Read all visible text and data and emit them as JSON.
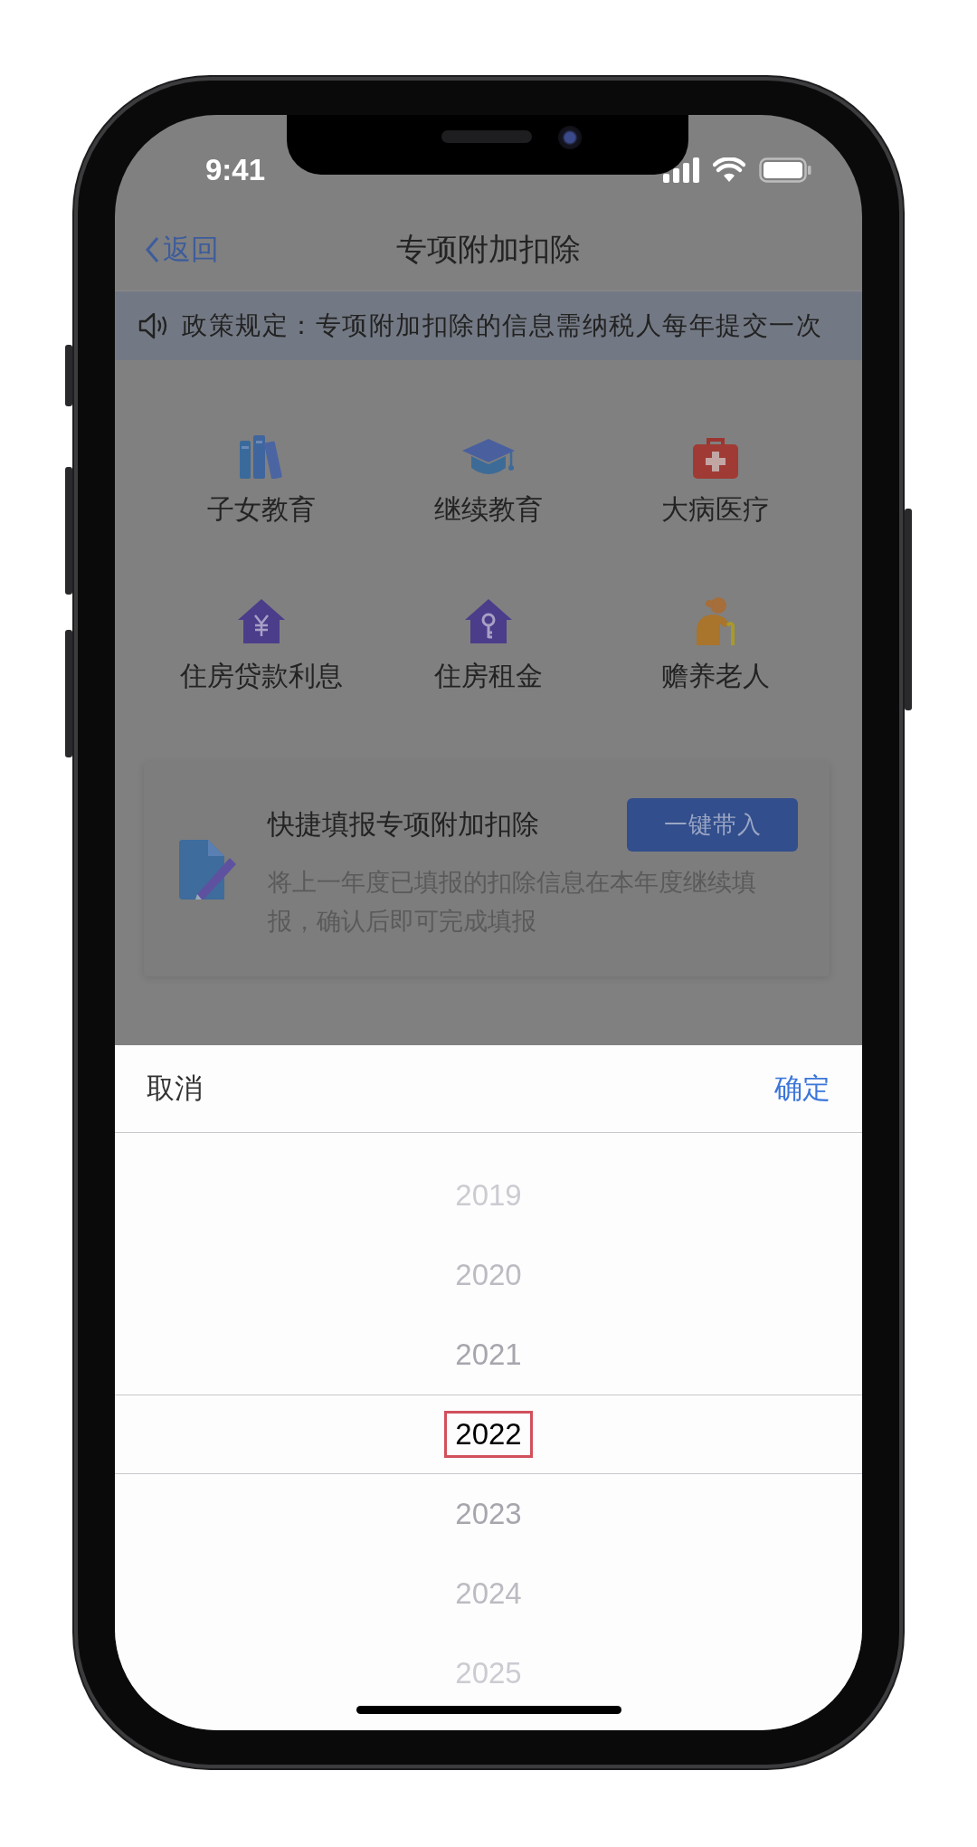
{
  "status_bar": {
    "time": "9:41"
  },
  "nav": {
    "back": "返回",
    "title": "专项附加扣除"
  },
  "notice": {
    "text": "政策规定：专项附加扣除的信息需纳税人每年提交一次"
  },
  "categories": [
    {
      "label": "子女教育"
    },
    {
      "label": "继续教育"
    },
    {
      "label": "大病医疗"
    },
    {
      "label": "住房贷款利息"
    },
    {
      "label": "住房租金"
    },
    {
      "label": "赡养老人"
    }
  ],
  "quick_fill": {
    "title": "快捷填报专项附加扣除",
    "button": "一键带入",
    "description": "将上一年度已填报的扣除信息在本年度继续填报，确认后即可完成填报"
  },
  "picker": {
    "cancel": "取消",
    "confirm": "确定",
    "years": [
      {
        "label": "2019",
        "selected": false,
        "highlighted": false
      },
      {
        "label": "2020",
        "selected": false,
        "highlighted": false
      },
      {
        "label": "2021",
        "selected": false,
        "highlighted": false
      },
      {
        "label": "2022",
        "selected": true,
        "highlighted": true
      },
      {
        "label": "2023",
        "selected": false,
        "highlighted": false
      },
      {
        "label": "2024",
        "selected": false,
        "highlighted": false
      },
      {
        "label": "2025",
        "selected": false,
        "highlighted": false
      }
    ]
  }
}
